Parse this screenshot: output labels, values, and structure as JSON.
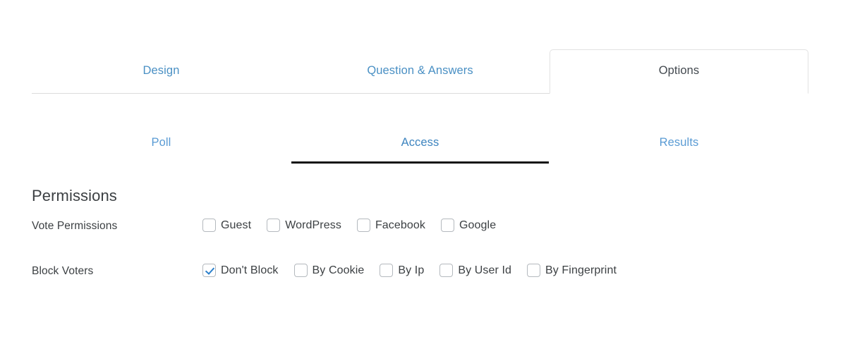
{
  "colors": {
    "tab_link": "#4a90c4",
    "tab_active_text": "#43494f",
    "subtab_link": "#5a9bd4",
    "subtab_active_text": "#3d84bf",
    "subtab_active_underline": "#111111",
    "checkbox_border": "#b4b9be",
    "checkmark": "#2a7fcb",
    "text": "#3c4043",
    "divider": "#dcdcdc"
  },
  "primary_tabs": [
    {
      "label": "Design",
      "active": false
    },
    {
      "label": "Question & Answers",
      "active": false
    },
    {
      "label": "Options",
      "active": true
    }
  ],
  "secondary_tabs": [
    {
      "label": "Poll",
      "active": false
    },
    {
      "label": "Access",
      "active": true
    },
    {
      "label": "Results",
      "active": false
    }
  ],
  "permissions": {
    "section_title": "Permissions",
    "vote_permissions": {
      "label": "Vote Permissions",
      "options": [
        {
          "label": "Guest",
          "checked": false
        },
        {
          "label": "WordPress",
          "checked": false
        },
        {
          "label": "Facebook",
          "checked": false
        },
        {
          "label": "Google",
          "checked": false
        }
      ]
    },
    "block_voters": {
      "label": "Block Voters",
      "options": [
        {
          "label": "Don't Block",
          "checked": true
        },
        {
          "label": "By Cookie",
          "checked": false
        },
        {
          "label": "By Ip",
          "checked": false
        },
        {
          "label": "By User Id",
          "checked": false
        },
        {
          "label": "By Fingerprint",
          "checked": false
        }
      ]
    }
  }
}
